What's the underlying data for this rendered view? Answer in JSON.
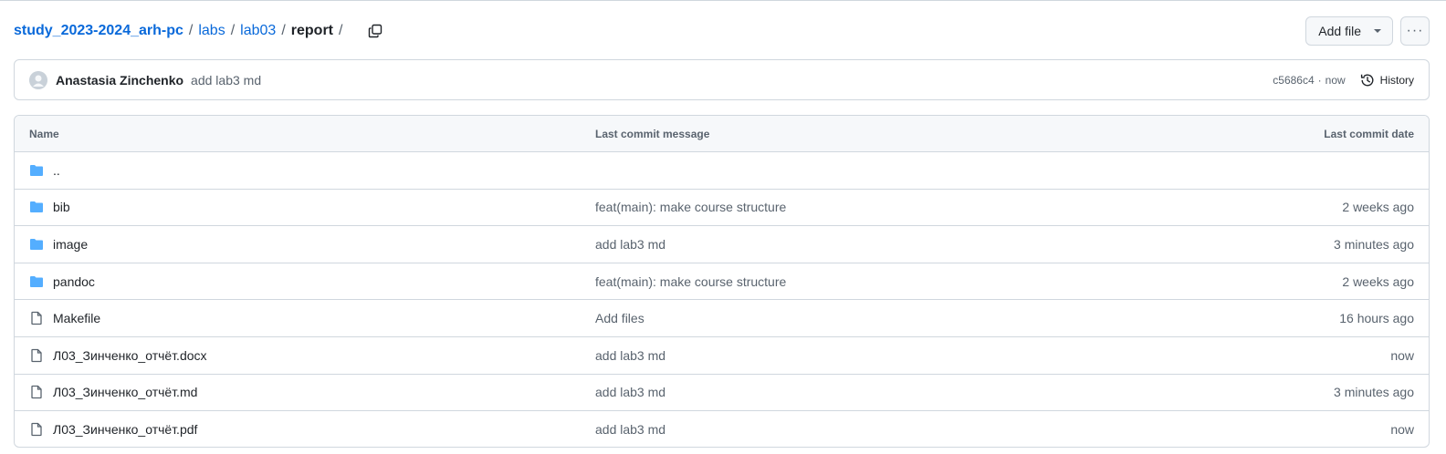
{
  "breadcrumb": {
    "repo": "study_2023-2024_arh-pc",
    "sep": "/",
    "parts": [
      "labs",
      "lab03"
    ],
    "current": "report"
  },
  "actions": {
    "add_file": "Add file",
    "more": "···"
  },
  "commit": {
    "author": "Anastasia Zinchenko",
    "message": "add lab3 md",
    "sha": "c5686c4",
    "dot": "·",
    "time": "now",
    "history": "History"
  },
  "table": {
    "headers": {
      "name": "Name",
      "message": "Last commit message",
      "date": "Last commit date"
    },
    "rows": [
      {
        "icon": "folder-icon",
        "name": "..",
        "message": "",
        "date": ""
      },
      {
        "icon": "folder-icon",
        "name": "bib",
        "message": "feat(main): make course structure",
        "date": "2 weeks ago"
      },
      {
        "icon": "folder-icon",
        "name": "image",
        "message": "add lab3 md",
        "date": "3 minutes ago"
      },
      {
        "icon": "folder-icon",
        "name": "pandoc",
        "message": "feat(main): make course structure",
        "date": "2 weeks ago"
      },
      {
        "icon": "file-icon",
        "name": "Makefile",
        "message": "Add files",
        "date": "16 hours ago"
      },
      {
        "icon": "file-icon",
        "name": "Л03_Зинченко_отчёт.docx",
        "message": "add lab3 md",
        "date": "now"
      },
      {
        "icon": "file-icon",
        "name": "Л03_Зинченко_отчёт.md",
        "message": "add lab3 md",
        "date": "3 minutes ago"
      },
      {
        "icon": "file-icon",
        "name": "Л03_Зинченко_отчёт.pdf",
        "message": "add lab3 md",
        "date": "now"
      }
    ]
  },
  "colors": {
    "link": "#0969da",
    "folder": "#54aeff",
    "border": "#d0d7de",
    "muted": "#59636e"
  }
}
